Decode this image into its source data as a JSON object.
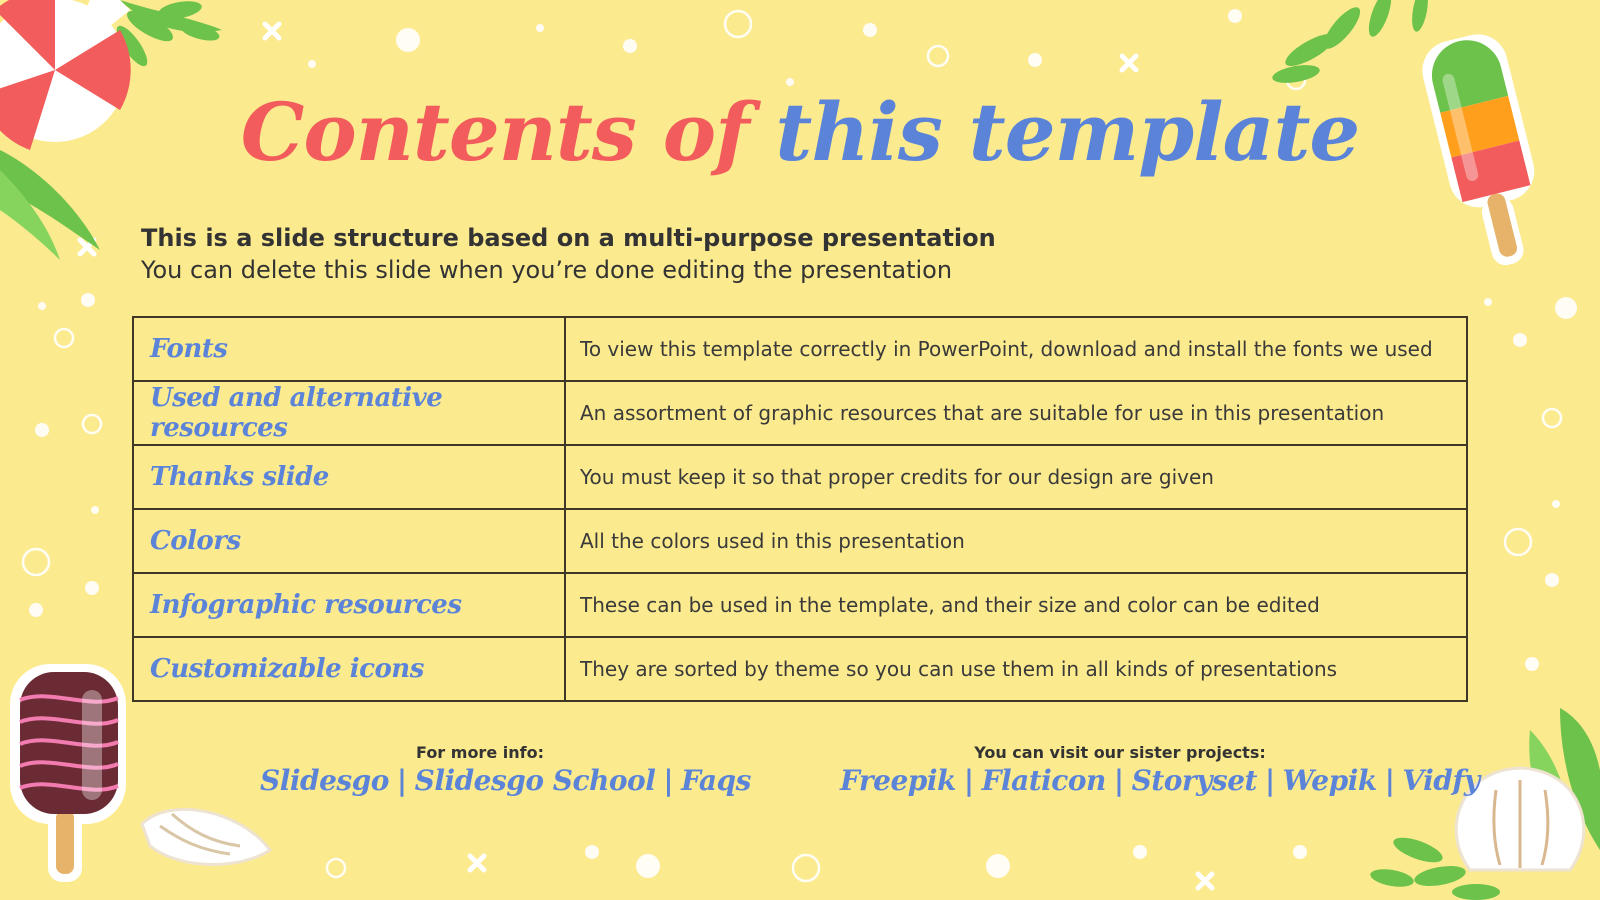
{
  "title": {
    "part1": "Contents of",
    "part2": "this template"
  },
  "subtitle": {
    "line1": "This is a slide structure based on a multi-purpose presentation",
    "line2": "You can delete this slide when you’re done editing the presentation"
  },
  "rows": [
    {
      "name": "Fonts",
      "desc": "To view this template correctly in PowerPoint, download and install the fonts we used"
    },
    {
      "name": "Used and alternative resources",
      "desc": "An assortment of graphic resources that are suitable for use in this presentation"
    },
    {
      "name": "Thanks slide",
      "desc": "You must keep it so that proper credits for our design are given"
    },
    {
      "name": "Colors",
      "desc": "All the colors used in this presentation"
    },
    {
      "name": "Infographic resources",
      "desc": "These can be used in the template, and their size and color can be edited"
    },
    {
      "name": "Customizable icons",
      "desc": "They are sorted by theme so you can use them in all kinds of presentations"
    }
  ],
  "more_info": {
    "label": "For more info:",
    "links": [
      "Slidesgo",
      "Slidesgo School",
      "Faqs"
    ],
    "separator": "|"
  },
  "sister": {
    "label": "You can visit our sister projects:",
    "links": [
      "Freepik",
      "Flaticon",
      "Storyset",
      "Wepik",
      "Vidfy"
    ],
    "separator": "|"
  },
  "colors": {
    "background": "#FBEA8E",
    "title_red": "#F25C5C",
    "title_blue": "#5B84D9",
    "leaf_green": "#6CC24A",
    "text_dark": "#333333"
  },
  "decorations": [
    "umbrella-icon",
    "palm-leaf-icon",
    "popsicle-icon",
    "ice-cream-icon",
    "seashell-icon",
    "sparkle-icon",
    "bubble-icon"
  ]
}
